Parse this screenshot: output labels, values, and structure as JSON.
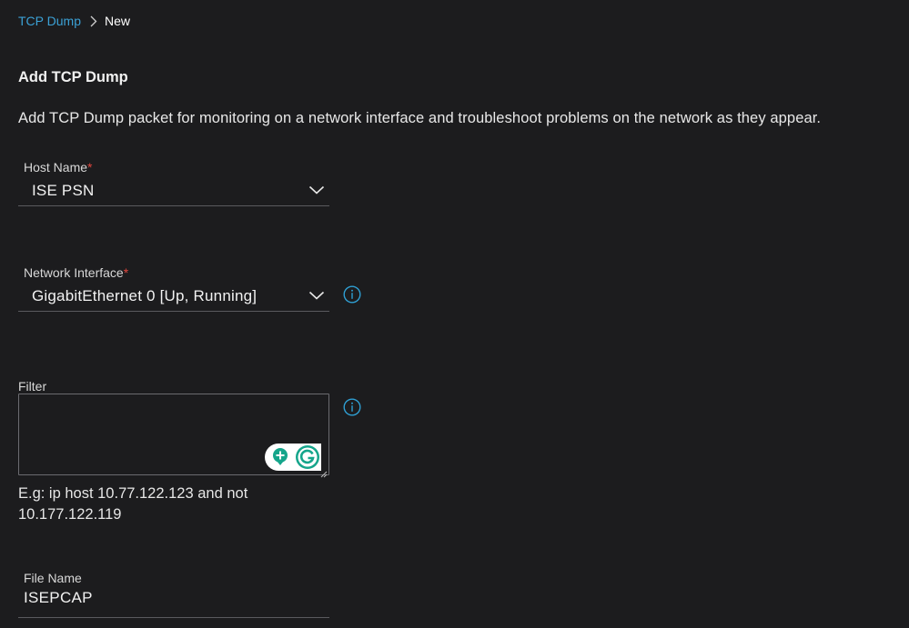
{
  "breadcrumb": {
    "parent": "TCP Dump",
    "current": "New"
  },
  "page": {
    "title": "Add TCP Dump",
    "description": "Add TCP Dump packet for monitoring on a network interface and troubleshoot problems on the network as they appear."
  },
  "form": {
    "host_name": {
      "label": "Host Name",
      "required_mark": "*",
      "value": "ISE PSN"
    },
    "network_interface": {
      "label": "Network Interface",
      "required_mark": "*",
      "value": "GigabitEthernet 0 [Up, Running]"
    },
    "filter": {
      "label": "Filter",
      "value": "",
      "hint_line1": "E.g: ip host 10.77.122.123 and not",
      "hint_line2": "10.177.122.119"
    },
    "file_name": {
      "label": "File Name",
      "value": "ISEPCAP"
    }
  },
  "icons": {
    "breadcrumb_separator": "chevron-right-icon",
    "dropdown": "chevron-down-icon",
    "info": "info-circle-icon",
    "grammarly": "grammarly-icon"
  },
  "colors": {
    "background": "#1c1c1e",
    "link": "#3ba1d6",
    "required": "#e0463d",
    "info_icon": "#2f9fd3",
    "grammarly_green": "#15a58b"
  }
}
